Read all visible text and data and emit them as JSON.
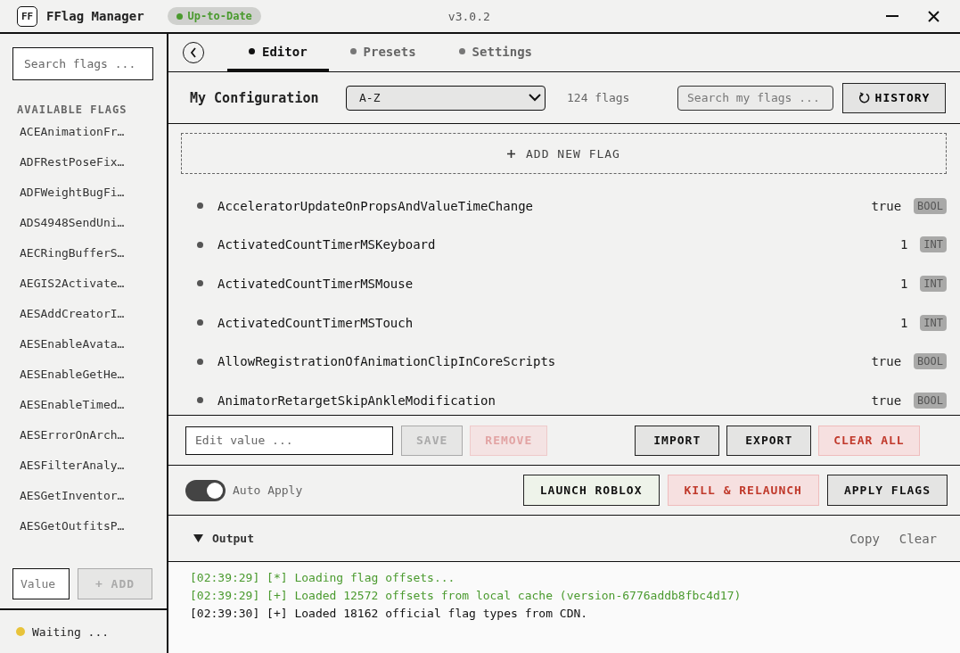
{
  "window": {
    "logo": "FF",
    "title": "FFlag Manager",
    "status_badge": "Up-to-Date",
    "version": "v3.0.2"
  },
  "sidebar": {
    "search": {
      "placeholder": "Search flags ..."
    },
    "heading": "AVAILABLE FLAGS",
    "items": [
      "ACEAnimationFr…",
      "ADFRestPoseFix…",
      "ADFWeightBugFi…",
      "ADS4948SendUni…",
      "AECRingBufferS…",
      "AEGIS2Activate…",
      "AESAddCreatorI…",
      "AESEnableAvata…",
      "AESEnableGetHe…",
      "AESEnableTimed…",
      "AESErrorOnArch…",
      "AESFilterAnaly…",
      "AESGetInventor…",
      "AESGetOutfitsP…"
    ],
    "value_field": {
      "placeholder": "Value"
    },
    "add_button": {
      "label": "+ ADD",
      "disabled": true
    },
    "status": {
      "text": "Waiting ...",
      "color": "#e8c33a"
    }
  },
  "tabs": [
    {
      "label": "Editor",
      "selected": true
    },
    {
      "label": "Presets",
      "selected": false
    },
    {
      "label": "Settings",
      "selected": false
    }
  ],
  "config": {
    "title": "My Configuration",
    "sort": "A-Z",
    "count": "124 flags",
    "search": {
      "placeholder": "Search my flags ..."
    },
    "history_button": "HISTORY"
  },
  "add_new_flag": "ADD NEW FLAG",
  "flags": [
    {
      "name": "AcceleratorUpdateOnPropsAndValueTimeChange",
      "value": "true",
      "type": "BOOL"
    },
    {
      "name": "ActivatedCountTimerMSKeyboard",
      "value": "1",
      "type": "INT"
    },
    {
      "name": "ActivatedCountTimerMSMouse",
      "value": "1",
      "type": "INT"
    },
    {
      "name": "ActivatedCountTimerMSTouch",
      "value": "1",
      "type": "INT"
    },
    {
      "name": "AllowRegistrationOfAnimationClipInCoreScripts",
      "value": "true",
      "type": "BOOL"
    },
    {
      "name": "AnimatorRetargetSkipAnkleModification",
      "value": "true",
      "type": "BOOL"
    }
  ],
  "edit": {
    "placeholder": "Edit value ...",
    "buttons": [
      {
        "label": "SAVE",
        "kind": "disabled"
      },
      {
        "label": "REMOVE",
        "kind": "danger-disabled"
      },
      {
        "label": "IMPORT",
        "kind": "normal"
      },
      {
        "label": "EXPORT",
        "kind": "normal"
      },
      {
        "label": "CLEAR ALL",
        "kind": "danger"
      }
    ]
  },
  "launch": {
    "auto_apply": {
      "label": "Auto Apply",
      "on": true
    },
    "buttons": [
      {
        "label": "LAUNCH ROBLOX",
        "kind": "launch"
      },
      {
        "label": "KILL & RELAUNCH",
        "kind": "danger"
      },
      {
        "label": "APPLY FLAGS",
        "kind": "normal"
      }
    ]
  },
  "output": {
    "title": "Output",
    "expanded": true,
    "actions": [
      "Copy",
      "Clear"
    ],
    "lines": [
      {
        "text": "[02:39:29] [*] Loading flag offsets...",
        "color": "#4a9a2e"
      },
      {
        "text": "[02:39:29] [+] Loaded 12572 offsets from local cache (version-6776addb8fbc4d17)",
        "color": "#4a9a2e"
      },
      {
        "text": "[02:39:30] [+] Loaded 18162 official flag types from CDN.",
        "color": "#111111"
      }
    ]
  }
}
